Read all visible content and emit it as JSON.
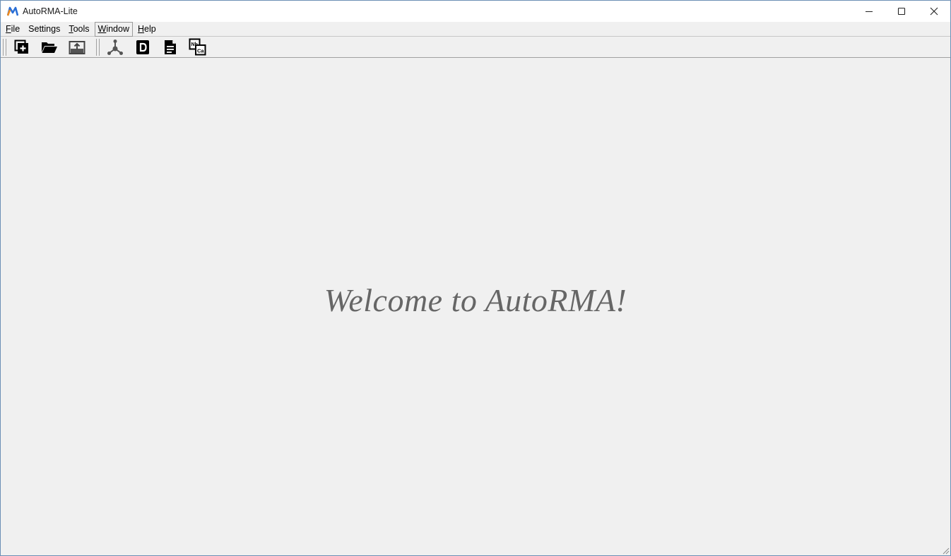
{
  "window": {
    "title": "AutoRMA-Lite",
    "controls": [
      "minimize",
      "maximize",
      "close"
    ]
  },
  "menu": {
    "items": [
      {
        "mnemonic": "F",
        "rest": "ile"
      },
      {
        "mnemonic": "",
        "rest": "Settings"
      },
      {
        "mnemonic": "T",
        "rest": "ools"
      },
      {
        "mnemonic": "W",
        "rest": "indow"
      },
      {
        "mnemonic": "H",
        "rest": "elp"
      }
    ]
  },
  "toolbar": {
    "icons": [
      "new-project-icon",
      "open-folder-icon",
      "import-image-icon",
      "network-graph-icon",
      "d-document-icon",
      "text-document-icon",
      "element-nb-ca-icon"
    ]
  },
  "main": {
    "welcome_text": "Welcome to AutoRMA!"
  },
  "colors": {
    "background": "#f0f0f0",
    "welcome_text": "#666666",
    "logo_blue": "#2a6fd6",
    "logo_orange": "#f08a1c"
  }
}
